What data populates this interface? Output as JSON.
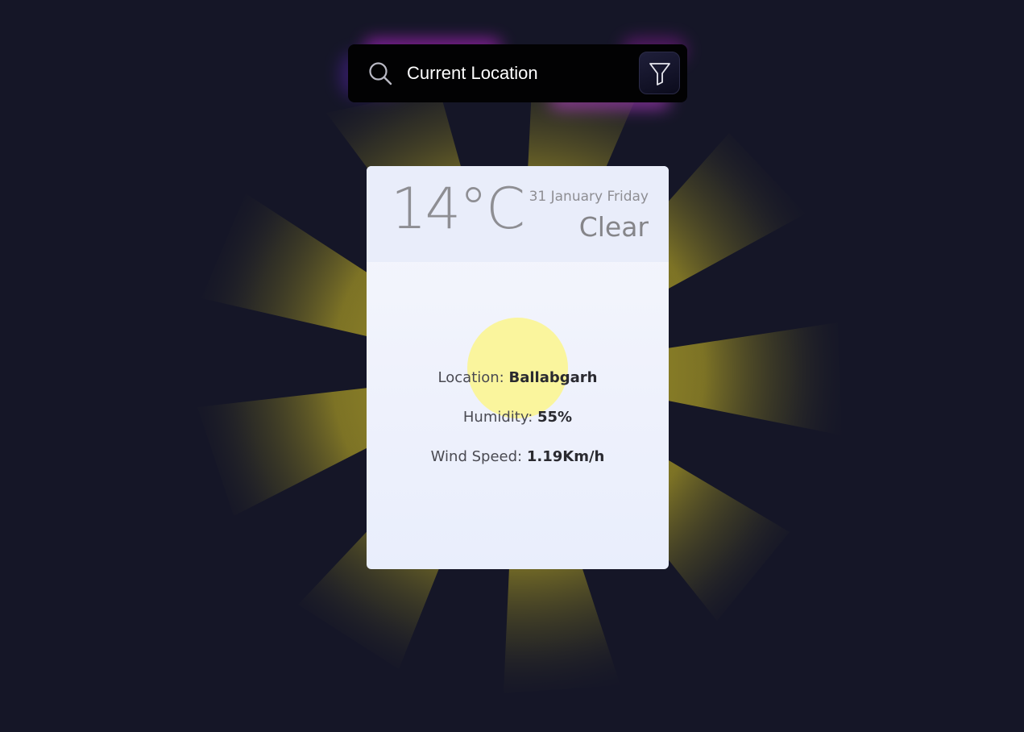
{
  "search": {
    "value": "Current Location"
  },
  "weather": {
    "temperature": "14°C",
    "date": "31 January Friday",
    "condition": "Clear",
    "location_label": "Location:",
    "location_value": "Ballabgarh",
    "humidity_label": "Humidity:",
    "humidity_value": "55%",
    "wind_label": "Wind Speed:",
    "wind_value": "1.19Km/h"
  },
  "icons": {
    "search": "search-icon",
    "filter": "filter-icon"
  },
  "colors": {
    "background": "#151627",
    "sun_ray": "#c9b92c",
    "sun": "#faf59d",
    "card": "#f4f6fd",
    "search_bg": "#020203",
    "glow": "#c026d3"
  }
}
